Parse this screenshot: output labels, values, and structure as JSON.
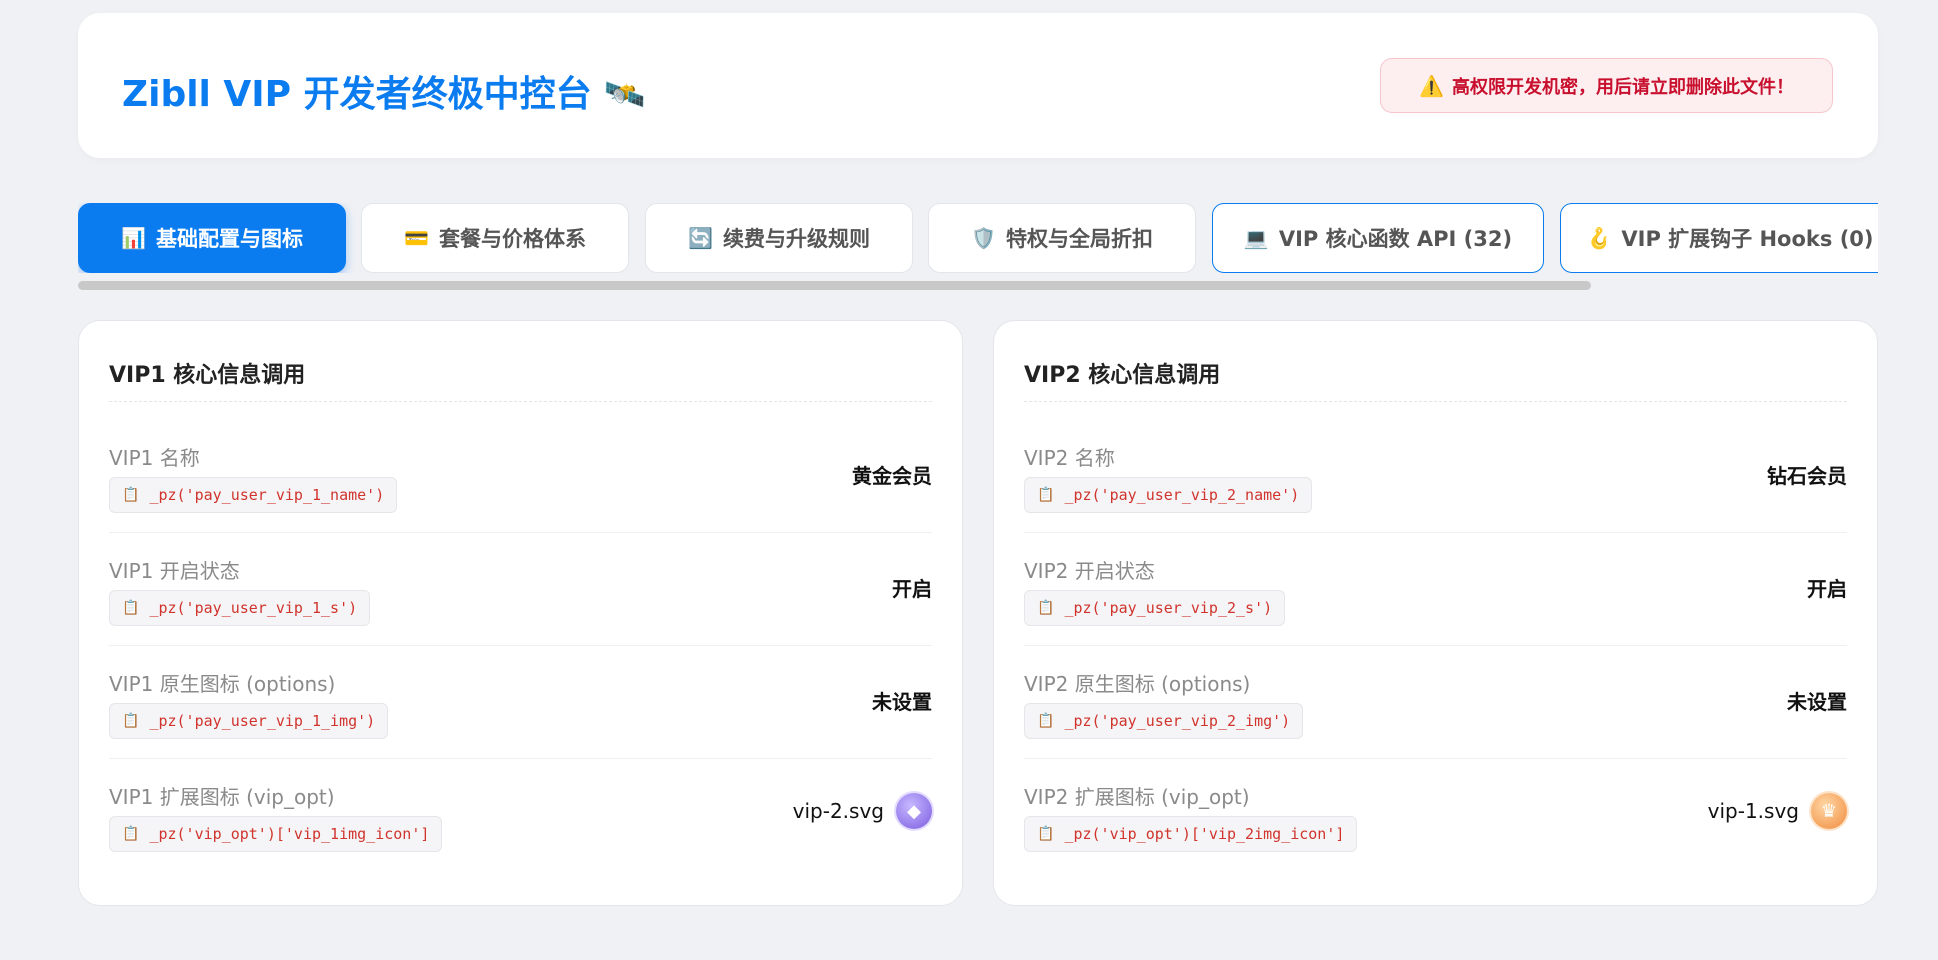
{
  "header": {
    "title": "Zibll VIP 开发者终极中控台",
    "title_icon": "🛰️",
    "warning_icon": "⚠️",
    "warning_text": "高权限开发机密，用后请立即删除此文件！"
  },
  "tabs": [
    {
      "icon": "📊",
      "label": "基础配置与图标"
    },
    {
      "icon": "💳",
      "label": "套餐与价格体系"
    },
    {
      "icon": "🔄",
      "label": "续费与升级规则"
    },
    {
      "icon": "🛡️",
      "label": "特权与全局折扣"
    },
    {
      "icon": "💻",
      "label": "VIP 核心函数 API (32)"
    },
    {
      "icon": "🪝",
      "label": "VIP 扩展钩子 Hooks (0)"
    }
  ],
  "code_icon": "📋",
  "cards": [
    {
      "title": "VIP1 核心信息调用",
      "rows": [
        {
          "label": "VIP1 名称",
          "code": "_pz('pay_user_vip_1_name')",
          "value": "黄金会员"
        },
        {
          "label": "VIP1 开启状态",
          "code": "_pz('pay_user_vip_1_s')",
          "value": "开启"
        },
        {
          "label": "VIP1 原生图标 (options)",
          "code": "_pz('pay_user_vip_1_img')",
          "value": "未设置"
        },
        {
          "label": "VIP1 扩展图标 (vip_opt)",
          "code": "_pz('vip_opt')['vip_1img_icon']",
          "value": "vip-2.svg",
          "icon": "diamond-icon"
        }
      ]
    },
    {
      "title": "VIP2 核心信息调用",
      "rows": [
        {
          "label": "VIP2 名称",
          "code": "_pz('pay_user_vip_2_name')",
          "value": "钻石会员"
        },
        {
          "label": "VIP2 开启状态",
          "code": "_pz('pay_user_vip_2_s')",
          "value": "开启"
        },
        {
          "label": "VIP2 原生图标 (options)",
          "code": "_pz('pay_user_vip_2_img')",
          "value": "未设置"
        },
        {
          "label": "VIP2 扩展图标 (vip_opt)",
          "code": "_pz('vip_opt')['vip_2img_icon']",
          "value": "vip-1.svg",
          "icon": "crown-icon"
        }
      ]
    }
  ],
  "colors": {
    "accent": "#0a7cf0",
    "warning_text": "#c8102e",
    "code_text": "#d0342c"
  }
}
